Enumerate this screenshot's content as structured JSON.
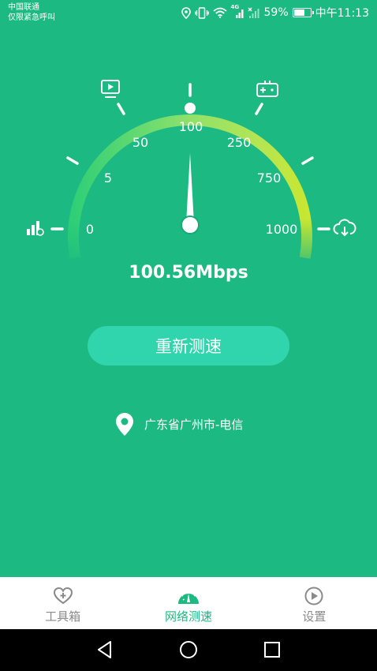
{
  "status_bar": {
    "carrier_line1": "中国联通",
    "carrier_line2": "仅限紧急呼叫",
    "battery_percent": "59%",
    "battery_level": 0.59,
    "network_label": "4G",
    "time": "中午11:13"
  },
  "gauge": {
    "scale_labels": [
      "0",
      "5",
      "50",
      "100",
      "250",
      "750",
      "1000"
    ],
    "current_value_mbps": 100.56,
    "icons": [
      "ping-icon",
      "video-icon",
      "game-icon",
      "download-icon"
    ],
    "arc_gradient": [
      "#2fcf77",
      "#b5e553",
      "#c8e632"
    ]
  },
  "result": {
    "speed_text": "100.56Mbps"
  },
  "actions": {
    "retest_label": "重新测速"
  },
  "location": {
    "text": "广东省广州市-电信"
  },
  "tabs": [
    {
      "label": "工具箱",
      "icon": "heart-plus-icon",
      "active": false
    },
    {
      "label": "网络测速",
      "icon": "speedometer-icon",
      "active": true
    },
    {
      "label": "设置",
      "icon": "play-circle-icon",
      "active": false
    }
  ],
  "colors": {
    "background": "#1cb982",
    "accent": "#1cb982",
    "button": "#31d5ad",
    "tab_inactive": "#8a8a8a"
  }
}
